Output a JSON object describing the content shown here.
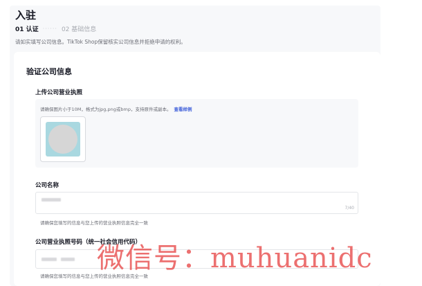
{
  "header": {
    "title": "入驻",
    "step_active": "01 认证",
    "step_separator": "······",
    "step_inactive": "02 基础信息",
    "notice": "请如实填写公司信息。TikTok Shop保留核实公司信息并拒绝申请的权利。"
  },
  "section": {
    "title": "验证公司信息"
  },
  "license_upload": {
    "label": "上传公司营业执照",
    "hint": "请确保图片小于10M，格式为jpg,png或bmp，支持原件或副本。",
    "example_link": "查看样例"
  },
  "company_name": {
    "label": "公司名称",
    "counter": "7/40",
    "helper": "请确保您填写的信息与您上传的营业执照信息完全一致"
  },
  "license_number": {
    "label": "公司营业执照号码（统一社会信用代码）",
    "helper": "请确保您填写的信息与您上传的营业执照信息完全一致"
  },
  "watermark": {
    "text": "微信号：muhuanidc",
    "color": "#e54040"
  },
  "colors": {
    "link": "#3a5bd9",
    "panel_bg": "#f7f8fa",
    "thumb_bg": "#a9d8e0"
  }
}
